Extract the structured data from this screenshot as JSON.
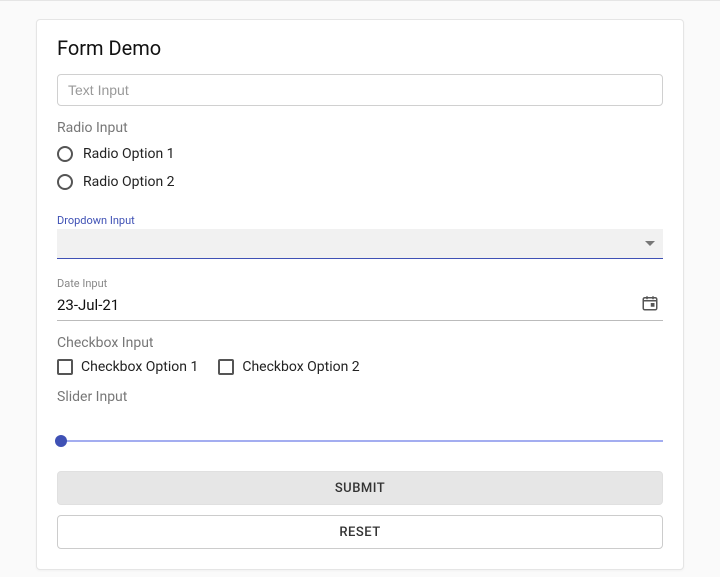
{
  "title": "Form Demo",
  "textInput": {
    "placeholder": "Text Input",
    "value": ""
  },
  "radio": {
    "label": "Radio Input",
    "options": [
      "Radio Option 1",
      "Radio Option 2"
    ]
  },
  "dropdown": {
    "label": "Dropdown Input",
    "value": ""
  },
  "date": {
    "label": "Date Input",
    "value": "23-Jul-21"
  },
  "checkbox": {
    "label": "Checkbox Input",
    "options": [
      "Checkbox Option 1",
      "Checkbox Option 2"
    ]
  },
  "slider": {
    "label": "Slider Input",
    "value": 0
  },
  "buttons": {
    "submit": "Submit",
    "reset": "Reset"
  }
}
